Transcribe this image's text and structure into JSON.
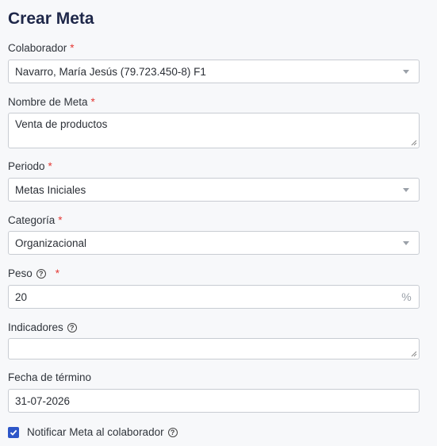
{
  "form": {
    "title": "Crear Meta",
    "required_mark": "*",
    "colaborador": {
      "label": "Colaborador",
      "value": "Navarro, María Jesús (79.723.450-8) F1"
    },
    "nombre_meta": {
      "label": "Nombre de Meta",
      "value": "Venta de productos"
    },
    "periodo": {
      "label": "Periodo",
      "value": "Metas Iniciales"
    },
    "categoria": {
      "label": "Categoría",
      "value": "Organizacional"
    },
    "peso": {
      "label": "Peso",
      "value": "20",
      "unit": "%"
    },
    "indicadores": {
      "label": "Indicadores",
      "value": ""
    },
    "fecha_termino": {
      "label": "Fecha de término",
      "value": "31-07-2026"
    },
    "notificar": {
      "label": "Notificar Meta al colaborador",
      "checked": true
    },
    "help_glyph": "?"
  },
  "colors": {
    "title": "#1e2749",
    "required": "#e53935",
    "checkbox": "#2d56c8",
    "border": "#c8ccd2"
  }
}
